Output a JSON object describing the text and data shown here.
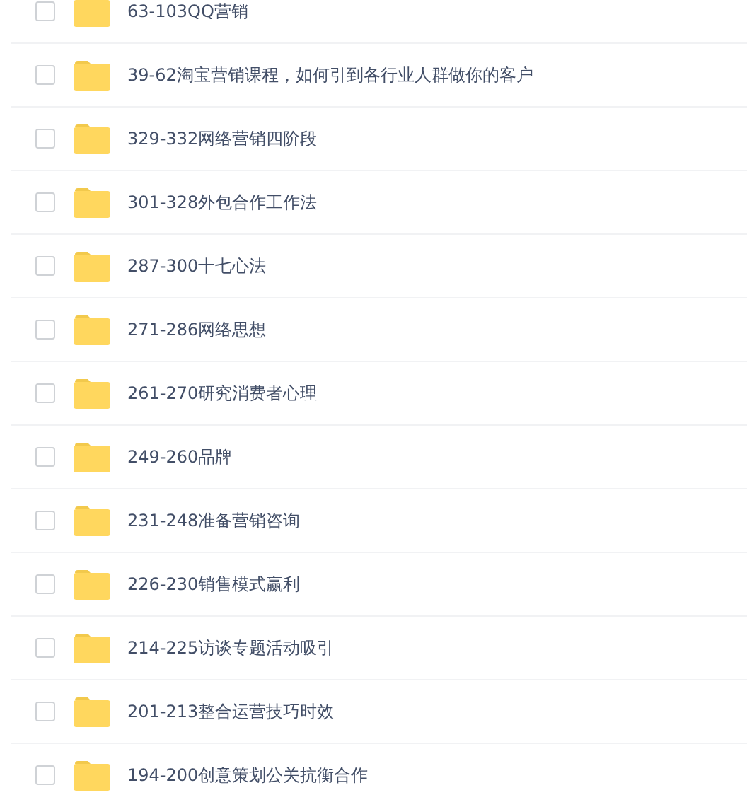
{
  "files": [
    {
      "name": "63-103QQ营销",
      "checked": false
    },
    {
      "name": "39-62淘宝营销课程，如何引到各行业人群做你的客户",
      "checked": false
    },
    {
      "name": "329-332网络营销四阶段",
      "checked": false
    },
    {
      "name": "301-328外包合作工作法",
      "checked": false
    },
    {
      "name": "287-300十七心法",
      "checked": false
    },
    {
      "name": "271-286网络思想",
      "checked": false
    },
    {
      "name": "261-270研究消费者心理",
      "checked": false
    },
    {
      "name": "249-260品牌",
      "checked": false
    },
    {
      "name": "231-248准备营销咨询",
      "checked": false
    },
    {
      "name": "226-230销售模式赢利",
      "checked": false
    },
    {
      "name": "214-225访谈专题活动吸引",
      "checked": false
    },
    {
      "name": "201-213整合运营技巧时效",
      "checked": false
    },
    {
      "name": "194-200创意策划公关抗衡合作",
      "checked": false
    }
  ]
}
